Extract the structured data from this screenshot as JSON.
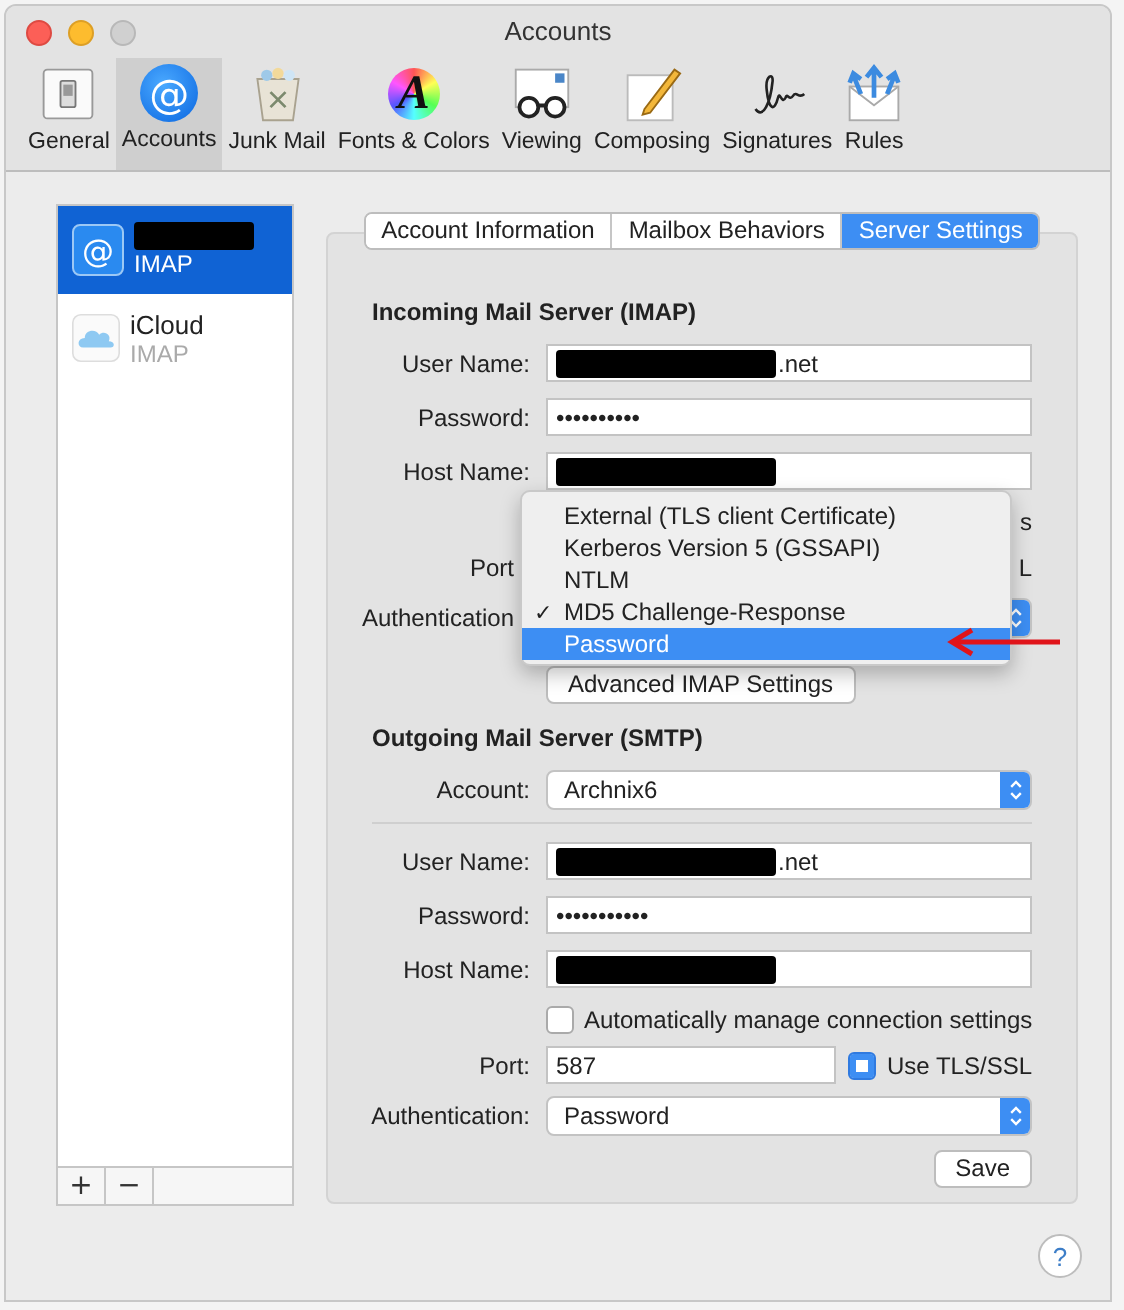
{
  "window": {
    "title": "Accounts"
  },
  "toolbar": [
    {
      "label": "General",
      "kind": "switch",
      "selected": false
    },
    {
      "label": "Accounts",
      "kind": "at",
      "glyph": "@",
      "selected": true
    },
    {
      "label": "Junk Mail",
      "kind": "trash",
      "selected": false
    },
    {
      "label": "Fonts & Colors",
      "kind": "font",
      "glyph": "A",
      "selected": false
    },
    {
      "label": "Viewing",
      "kind": "glasses",
      "selected": false
    },
    {
      "label": "Composing",
      "kind": "pencil",
      "selected": false
    },
    {
      "label": "Signatures",
      "kind": "signature",
      "selected": false
    },
    {
      "label": "Rules",
      "kind": "rules",
      "selected": false
    }
  ],
  "sidebar": {
    "accounts": [
      {
        "redacted": true,
        "type": "IMAP",
        "kind": "at",
        "glyph": "@",
        "selected": true
      },
      {
        "name": "iCloud",
        "type": "IMAP",
        "kind": "cloud",
        "selected": false
      }
    ],
    "buttons": [
      "+",
      "−"
    ]
  },
  "tabs": [
    {
      "label": "Account Information",
      "selected": false
    },
    {
      "label": "Mailbox Behaviors",
      "selected": false
    },
    {
      "label": "Server Settings",
      "selected": true
    }
  ],
  "incoming": {
    "title": "Incoming Mail Server (IMAP)",
    "rows": [
      {
        "kind": "field",
        "label": "User Name:",
        "value": ".net",
        "redacted": true
      },
      {
        "kind": "field",
        "label": "Password:",
        "value": "••••••••••"
      },
      {
        "kind": "field",
        "label": "Host Name:",
        "redacted": true
      },
      {
        "kind": "tail",
        "right_text": "s"
      },
      {
        "kind": "tail",
        "label": "Port",
        "right_text": "L"
      },
      {
        "kind": "popup",
        "label": "Authentication"
      },
      {
        "kind": "button",
        "label": "Advanced IMAP Settings"
      }
    ]
  },
  "auth_menu": {
    "items": [
      {
        "label": "External (TLS client Certificate)",
        "checked": false,
        "selected": false
      },
      {
        "label": "Kerberos Version 5 (GSSAPI)",
        "checked": false,
        "selected": false
      },
      {
        "label": "NTLM",
        "checked": false,
        "selected": false
      },
      {
        "label": "MD5 Challenge-Response",
        "checked": true,
        "selected": false
      },
      {
        "label": "Password",
        "checked": false,
        "selected": true
      }
    ],
    "check_glyph": "✓"
  },
  "outgoing": {
    "title": "Outgoing Mail Server (SMTP)",
    "rows": [
      {
        "kind": "popup",
        "label": "Account:",
        "value": "Archnix6"
      },
      {
        "kind": "divider"
      },
      {
        "kind": "field",
        "label": "User Name:",
        "value": ".net",
        "redacted": true
      },
      {
        "kind": "field",
        "label": "Password:",
        "value": "•••••••••••"
      },
      {
        "kind": "field",
        "label": "Host Name:",
        "redacted": true
      },
      {
        "kind": "checkbox",
        "label": "Automatically manage connection settings",
        "checked": false
      },
      {
        "kind": "port",
        "label": "Port:",
        "value": "587",
        "option": {
          "label": "Use TLS/SSL",
          "checked": true
        }
      },
      {
        "kind": "popup",
        "label": "Authentication:",
        "value": "Password"
      },
      {
        "kind": "action_button",
        "label": "Save"
      }
    ]
  },
  "help": "?"
}
